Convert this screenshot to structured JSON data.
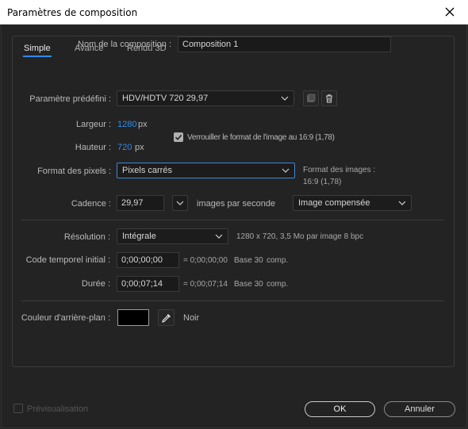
{
  "window": {
    "title": "Paramètres de composition"
  },
  "comp_name": {
    "label": "Nom de la composition :",
    "value": "Composition 1"
  },
  "tabs": [
    {
      "label": "Simple",
      "active": true
    },
    {
      "label": "Avancé",
      "active": false
    },
    {
      "label": "Rendu 3D",
      "active": false
    }
  ],
  "preset": {
    "label": "Paramètre prédéfini :",
    "value": "HDV/HDTV 720 29,97"
  },
  "width": {
    "label": "Largeur :",
    "value": "1280",
    "unit": "px"
  },
  "height": {
    "label": "Hauteur :",
    "value": "720",
    "unit": "px"
  },
  "lock_ratio": {
    "label": "Verrouiller le format de l'image au 16:9 (1,78)",
    "checked": true
  },
  "pixel_aspect": {
    "label": "Format des pixels :",
    "value": "Pixels carrés"
  },
  "frame_aspect": {
    "label": "Format des images :",
    "value": "16:9 (1,78)"
  },
  "frame_rate": {
    "label": "Cadence :",
    "value": "29,97",
    "unit_label": "images par seconde",
    "mode": "Image compensée"
  },
  "resolution": {
    "label": "Résolution :",
    "value": "Intégrale",
    "info": "1280 x 720, 3,5 Mo par image 8 bpc"
  },
  "start_timecode": {
    "label": "Code temporel initial :",
    "value": "0;00;00;00",
    "equals": "= 0;00;00;00",
    "base": "Base 30",
    "comp": "comp."
  },
  "duration": {
    "label": "Durée :",
    "value": "0;00;07;14",
    "equals": "= 0;00;07;14",
    "base": "Base 30",
    "comp": "comp."
  },
  "background": {
    "label": "Couleur d'arrière-plan :",
    "color_name": "Noir",
    "swatch_color": "#000000"
  },
  "preview": {
    "label": "Prévisualisation",
    "checked": false
  },
  "buttons": {
    "ok": "OK",
    "cancel": "Annuler"
  },
  "colors": {
    "accent": "#2d8ceb",
    "background": "#232323"
  },
  "icons": {
    "close": "close-icon",
    "save_preset": "save-preset-icon",
    "delete_preset": "trash-icon",
    "eyedropper": "eyedropper-icon",
    "chevron": "chevron-down-icon",
    "checkmark": "checkmark-icon"
  }
}
